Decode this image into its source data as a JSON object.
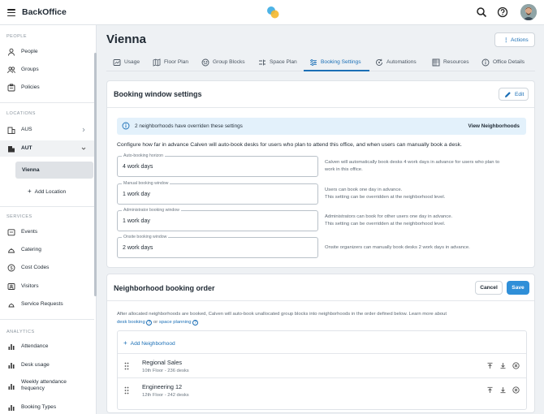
{
  "app": {
    "title": "BackOffice"
  },
  "sidebar": {
    "sections": [
      {
        "label": "PEOPLE"
      },
      {
        "label": "LOCATIONS"
      },
      {
        "label": "SERVICES"
      },
      {
        "label": "ANALYTICS"
      }
    ],
    "people": [
      "People",
      "Groups",
      "Policies"
    ],
    "locations": [
      "AUS",
      "AUT"
    ],
    "selected_location": "Vienna",
    "add_location": "Add Location",
    "services": [
      "Events",
      "Catering",
      "Cost Codes",
      "Visitors",
      "Service Requests"
    ],
    "analytics": [
      "Attendance",
      "Desk usage",
      "Weekly attendance",
      "frequency",
      "Booking Types"
    ]
  },
  "page": {
    "title": "Vienna",
    "actions_label": "Actions"
  },
  "tabs": [
    {
      "label": "Usage"
    },
    {
      "label": "Floor Plan"
    },
    {
      "label": "Group Blocks"
    },
    {
      "label": "Space Plan"
    },
    {
      "label": "Booking Settings"
    },
    {
      "label": "Automations"
    },
    {
      "label": "Resources"
    },
    {
      "label": "Office Details"
    }
  ],
  "booking_window": {
    "title": "Booking window settings",
    "edit_label": "Edit",
    "banner_text": "2 neighborhoods have overriden these settings",
    "banner_link": "View Neighborhoods",
    "intro": "Configure how far in advance Calven will auto-book desks for users who plan to attend this office, and when users can manually book a desk.",
    "fields": [
      {
        "label": "Auto-booking horizon",
        "value": "4 work days",
        "help1": "Calven will automatically book desks 4 work days in advance for users who plan to",
        "help2": "work in this office."
      },
      {
        "label": "Manual booking window",
        "value": "1 work day",
        "help1": "Users can book one day in advance.",
        "help2": "This setting can be overridden at the neighborhood level."
      },
      {
        "label": "Administrator booking window",
        "value": "1 work day",
        "help1": "Administrators can book for other users one day in advance.",
        "help2": "This setting can be overridden at the neighborhood level."
      },
      {
        "label": "Onsite booking window",
        "value": "2 work days",
        "help1": "Onsite organizers can manually book desks 2 work days in advance.",
        "help2": ""
      }
    ]
  },
  "neighborhood_order": {
    "title": "Neighborhood booking order",
    "cancel_label": "Cancel",
    "save_label": "Save",
    "desc": "After allocated neighborhoods are booked, Calven will auto-book unallocated group blocks into neighborhoods in the order defined below. Learn more about",
    "desk_booking_link": "desk booking",
    "or_text": "or",
    "space_planning_link": "space planning",
    "add_label": "Add Neighborhood",
    "rows": [
      {
        "name": "Regional Sales",
        "detail": "10th Floor - 236 desks"
      },
      {
        "name": "Engineering 12",
        "detail": "12th Floor - 242 desks"
      }
    ]
  },
  "colors": {
    "accent": "#1b6fb6",
    "primary_button": "#2f8fd8",
    "banner_bg": "#e3f1fb"
  }
}
